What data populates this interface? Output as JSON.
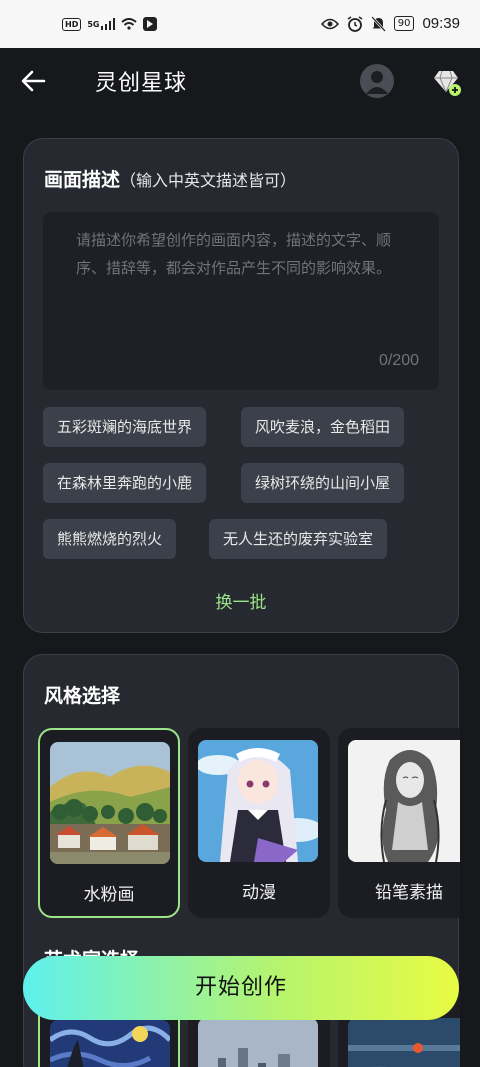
{
  "status_bar": {
    "left_indicators": [
      "HD",
      "5G"
    ],
    "battery": "90",
    "time": "09:39"
  },
  "header": {
    "title": "灵创星球"
  },
  "description": {
    "heading": "画面描述",
    "heading_note": "（输入中英文描述皆可）",
    "placeholder": "请描述你希望创作的画面内容，描述的文字、顺序、措辞等，都会对作品产生不同的影响效果。",
    "counter": "0/200",
    "suggestions": [
      "五彩斑斓的海底世界",
      "风吹麦浪，金色稻田",
      "在森林里奔跑的小鹿",
      "绿树环绕的山间小屋",
      "熊熊燃烧的烈火",
      "无人生还的废弃实验室"
    ],
    "refresh_label": "换一批"
  },
  "style": {
    "heading": "风格选择",
    "items": [
      {
        "label": "水粉画",
        "selected": true
      },
      {
        "label": "动漫",
        "selected": false
      },
      {
        "label": "铅笔素描",
        "selected": false
      }
    ],
    "accent_color": "#9be48a"
  },
  "artist": {
    "heading": "艺术家选择"
  },
  "start_button": {
    "label": "开始创作"
  }
}
